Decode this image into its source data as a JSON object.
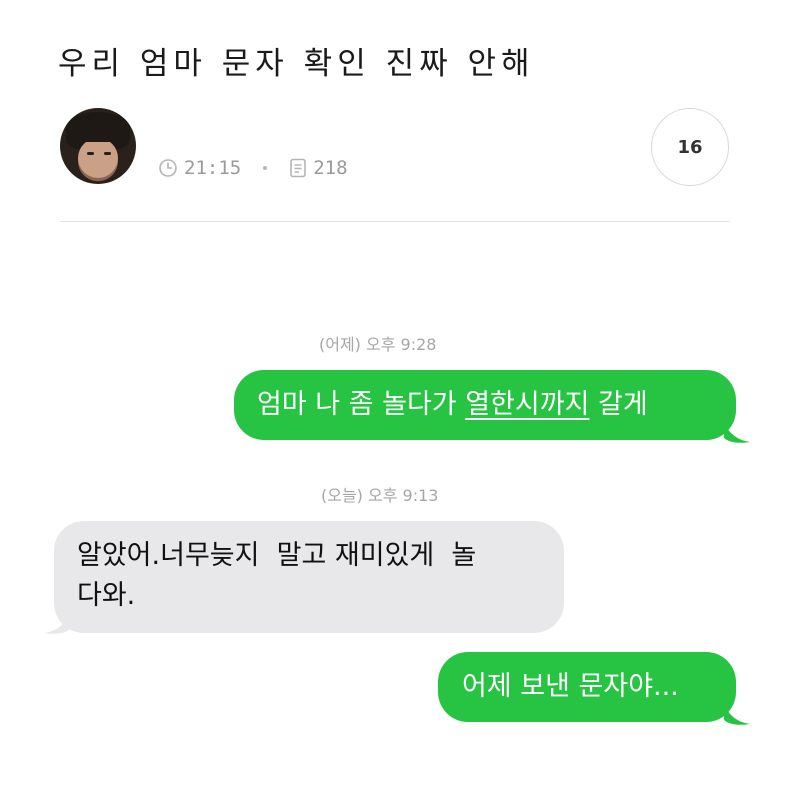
{
  "post": {
    "title": "우리 엄마 문자 확인 진짜 안해",
    "time": "21:15",
    "views": "218",
    "comment_count": "16"
  },
  "icons": {
    "time": "clock-icon",
    "views": "document-icon"
  },
  "colors": {
    "sent_bubble": "#27c342",
    "received_bubble": "#e8e8ea"
  },
  "messages": [
    {
      "type": "timestamp",
      "text": "(어제) 오후 9:28"
    },
    {
      "type": "sent",
      "text_before": "엄마 나 좀 놀다가 ",
      "text_underlined": "열한시까지",
      "text_after": " 갈게"
    },
    {
      "type": "timestamp",
      "text": "(오늘) 오후 9:13"
    },
    {
      "type": "received",
      "line1": "알았어.너무늦지  말고 재미있게  놀",
      "line2": "다와."
    },
    {
      "type": "sent",
      "text": "어제 보낸 문자야..."
    }
  ]
}
